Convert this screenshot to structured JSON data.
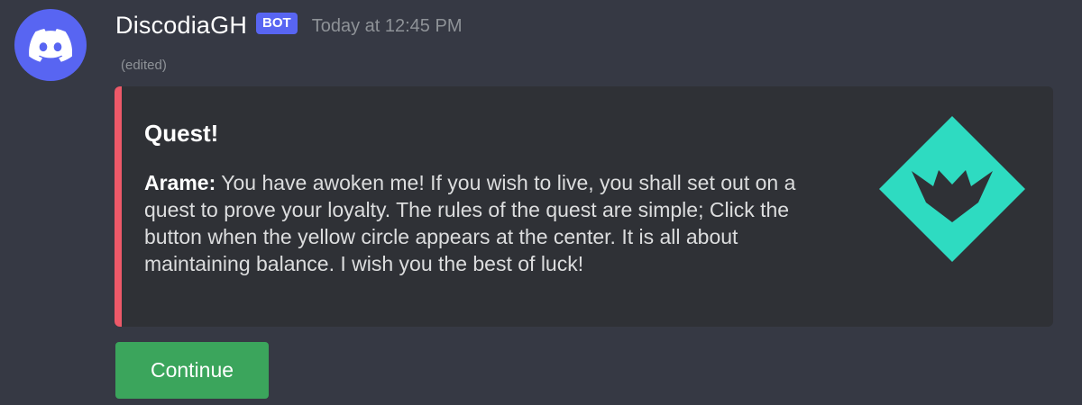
{
  "message": {
    "author": "DiscodiaGH",
    "badge": "BOT",
    "timestamp": "Today at 12:45 PM",
    "edited_label": "(edited)",
    "avatar_icon": "discord-logo-icon",
    "avatar_color": "#5865f2"
  },
  "embed": {
    "accent_color": "#ed5969",
    "title": "Quest!",
    "speaker": "Arame:",
    "text": " You have awoken me! If you wish to live, you shall set out on a quest to prove your loyalty. The rules of the quest are simple; Click the button when the yellow circle appears at the center. It is all about maintaining balance. I wish you the best of luck!",
    "thumbnail_icon": "teal-diamond-emblem-icon",
    "thumbnail_color": "#2edbc1"
  },
  "components": {
    "continue_label": "Continue",
    "continue_color": "#3ba55c"
  }
}
